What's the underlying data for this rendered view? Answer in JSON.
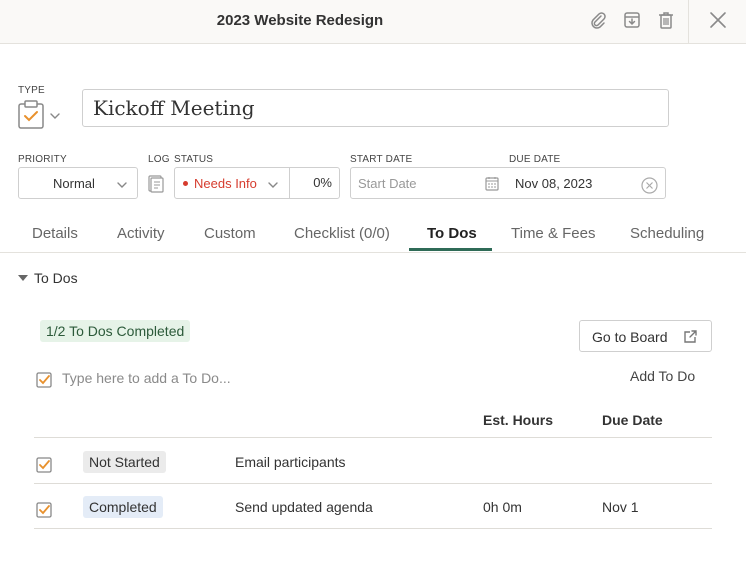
{
  "header": {
    "title": "2023 Website Redesign"
  },
  "form": {
    "type_label": "TYPE",
    "title_value": "Kickoff Meeting",
    "priority_label": "PRIORITY",
    "priority_value": "Normal",
    "log_label": "LOG",
    "status_label": "STATUS",
    "status_value": "Needs Info",
    "status_color": "#d63c2e",
    "percent_value": "0%",
    "start_date_label": "START DATE",
    "start_date_placeholder": "Start Date",
    "due_date_label": "DUE DATE",
    "due_date_value": "Nov 08, 2023"
  },
  "tabs": [
    {
      "label": "Details"
    },
    {
      "label": "Activity"
    },
    {
      "label": "Custom"
    },
    {
      "label": "Checklist (0/0)"
    },
    {
      "label": "To Dos",
      "active": true
    },
    {
      "label": "Time & Fees"
    },
    {
      "label": "Scheduling"
    }
  ],
  "todos": {
    "section_title": "To Dos",
    "completed_badge": "1/2 To Dos Completed",
    "go_to_board": "Go to Board",
    "input_placeholder": "Type here to add a To Do...",
    "add_button": "Add To Do",
    "columns": {
      "hours": "Est. Hours",
      "due": "Due Date"
    },
    "rows": [
      {
        "status": "Not Started",
        "title": "Email participants",
        "hours": "",
        "due": ""
      },
      {
        "status": "Completed",
        "title": "Send updated agenda",
        "hours": "0h 0m",
        "due": "Nov 1"
      }
    ]
  },
  "colors": {
    "accent": "#2f6b57",
    "checkbox_orange": "#e8912d"
  }
}
